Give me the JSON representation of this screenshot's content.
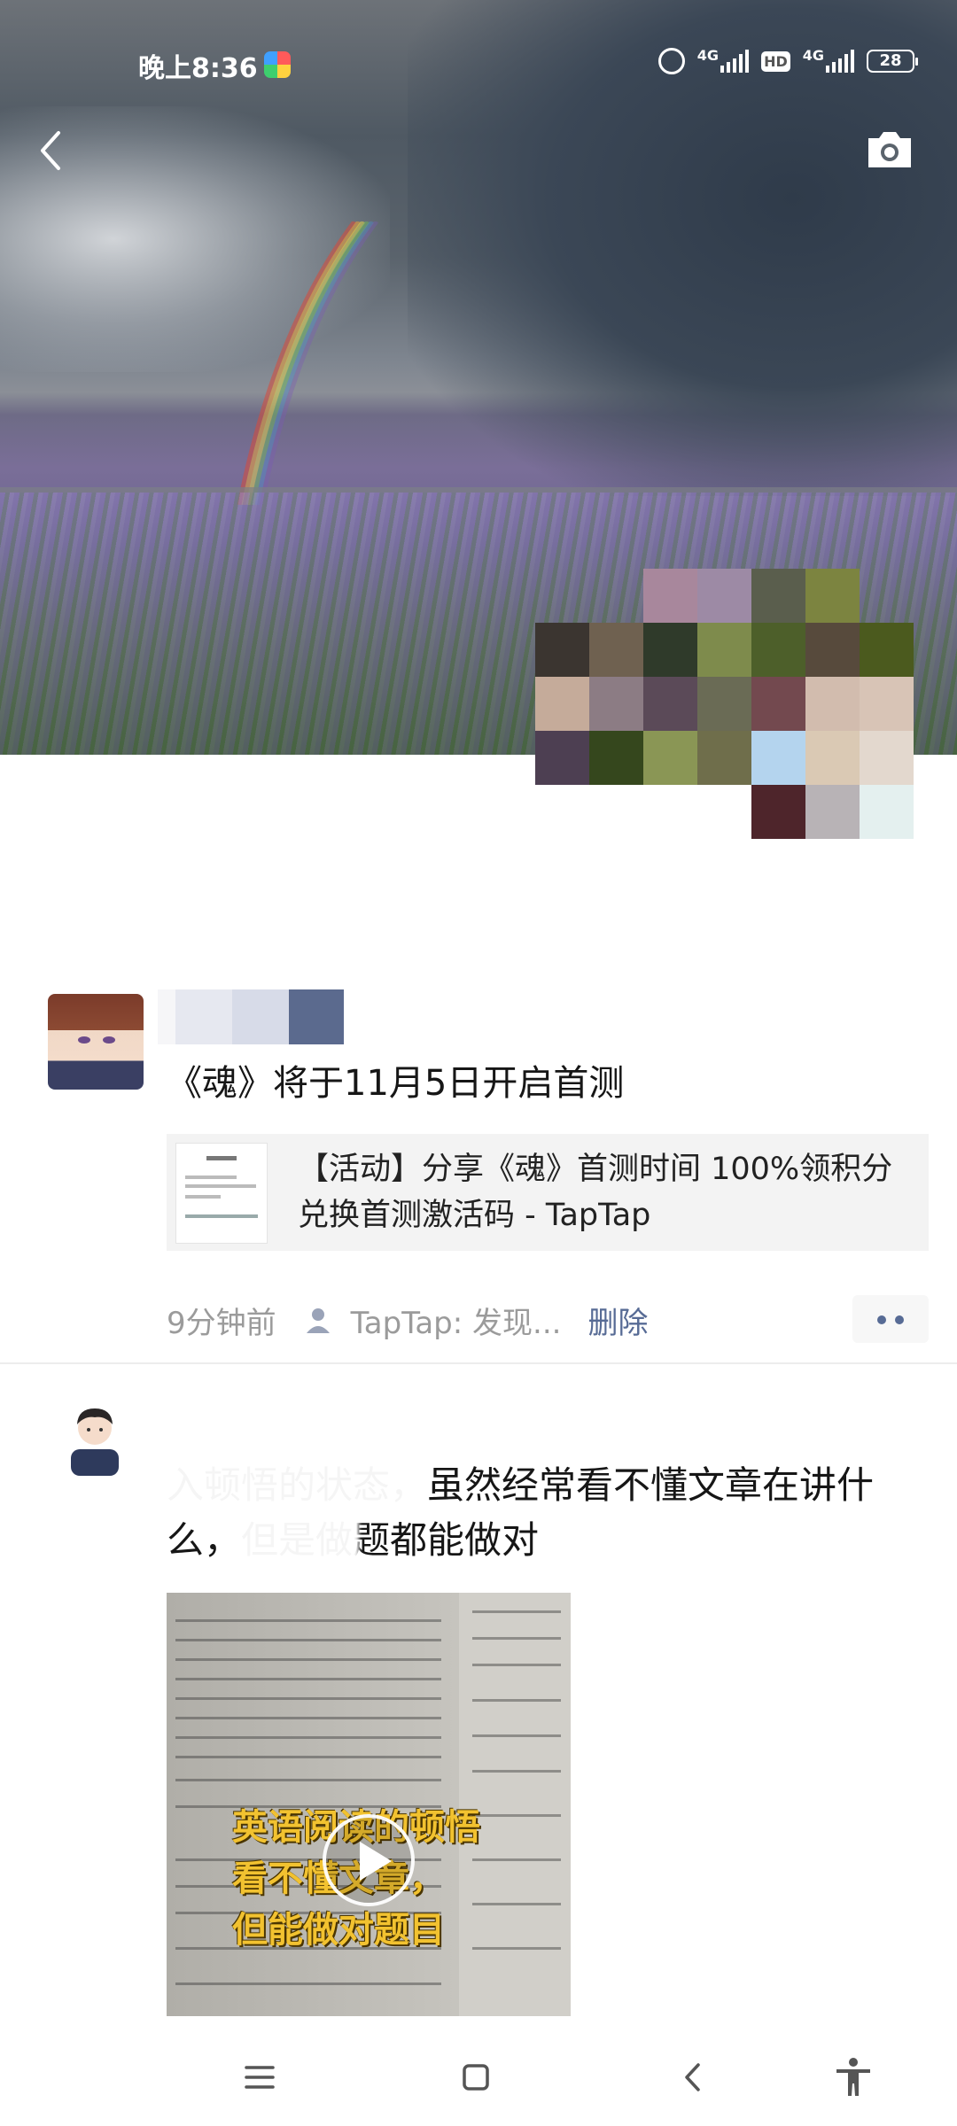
{
  "status_bar": {
    "time": "晚上8:36",
    "network1": "4G",
    "network2": "4G",
    "hd": "HD",
    "battery": "28"
  },
  "colors": {
    "link": "#576b95",
    "meta_gray": "#9b9b9b",
    "caption_yellow": "#f2c230"
  },
  "posts": [
    {
      "text": "《魂》将于11月5日开启首测",
      "link_card": {
        "title": "【活动】分享《魂》首测时间 100%领积分兑换首测激活码 - TapTap"
      },
      "meta": {
        "time": "9分钟前",
        "source": "TapTap: 发现...",
        "delete_label": "删除"
      }
    },
    {
      "text": "入顿悟的状态，虽然经常看不懂文章在讲什么，但是做题都能做对",
      "video": {
        "caption_lines": [
          "英语阅读的顿悟",
          "看不懂文章，",
          "但能做对题目"
        ]
      }
    }
  ],
  "icons": {
    "back": "chevron-left-icon",
    "camera": "camera-icon",
    "nav_menu": "menu-icon",
    "nav_home": "home-square-icon",
    "nav_back": "back-chevron-icon",
    "nav_accessibility": "accessibility-icon"
  }
}
